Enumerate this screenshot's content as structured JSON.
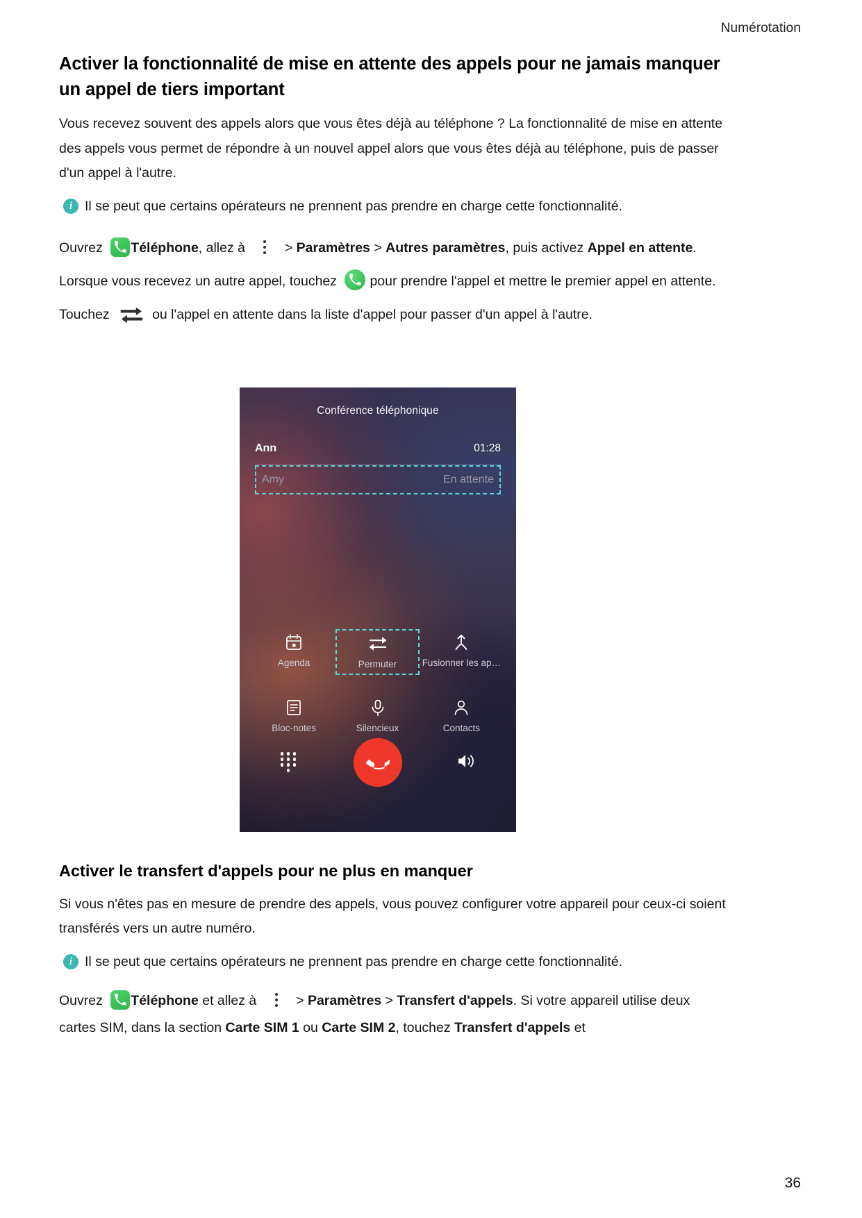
{
  "header": {
    "running_title": "Numérotation"
  },
  "page_number": "36",
  "section1": {
    "title": "Activer la fonctionnalité de mise en attente des appels pour ne jamais manquer un appel de tiers important",
    "paragraph": "Vous recevez souvent des appels alors que vous êtes déjà au téléphone ? La fonctionnalité de mise en attente des appels vous permet de répondre à un nouvel appel alors que vous êtes déjà au téléphone, puis de passer d'un appel à l'autre.",
    "note": "Il se peut que certains opérateurs ne prennent pas prendre en charge cette fonctionnalité.",
    "steps": {
      "t1": "Ouvrez",
      "app_label": "Téléphone",
      "t2": ", allez à",
      "sep1": ">",
      "settings": "Paramètres",
      "sep2": ">",
      "other_settings": "Autres paramètres",
      "t3": ", puis activez",
      "feature_a": "Appel en",
      "feature_b": "attente",
      "t4": ". Lorsque vous recevez un autre appel, touchez",
      "t5": "pour prendre l'appel et mettre le premier appel en attente. Touchez",
      "t6": "ou l'appel en attente dans la liste d'appel pour passer d'un appel à l'autre."
    }
  },
  "screenshot": {
    "title": "Conférence téléphonique",
    "calls": [
      {
        "name": "Ann",
        "status": "01:28",
        "held": false
      },
      {
        "name": "Amy",
        "status": "En attente",
        "held": true
      }
    ],
    "actions": [
      {
        "label": "Agenda",
        "icon": "calendar-icon",
        "selected": false
      },
      {
        "label": "Permuter",
        "icon": "swap-icon",
        "selected": true
      },
      {
        "label": "Fusionner les ap…",
        "icon": "merge-call-icon",
        "selected": false
      },
      {
        "label": "Bloc-notes",
        "icon": "notepad-icon",
        "selected": false
      },
      {
        "label": "Silencieux",
        "icon": "microphone-icon",
        "selected": false
      },
      {
        "label": "Contacts",
        "icon": "contacts-icon",
        "selected": false
      }
    ],
    "bottom": {
      "keypad": "keypad-icon",
      "hangup": "end-call-icon",
      "speaker": "speaker-icon",
      "hangup_color": "#f0372b"
    }
  },
  "section2": {
    "title": "Activer le transfert d'appels pour ne plus en manquer",
    "paragraph": "Si vous n'êtes pas en mesure de prendre des appels, vous pouvez configurer votre appareil pour ceux-ci soient transférés vers un autre numéro.",
    "note": "Il se peut que certains opérateurs ne prennent pas prendre en charge cette fonctionnalité.",
    "steps": {
      "t1": "Ouvrez",
      "app_label": "Téléphone",
      "t2": "et allez à",
      "sep1": ">",
      "settings": "Paramètres",
      "sep2": ">",
      "forwarding": "Transfert d'appels",
      "t3": ". Si votre appareil utilise deux cartes SIM, dans la section",
      "sim1": "Carte SIM 1",
      "t4": "ou",
      "sim2": "Carte SIM 2",
      "t5": ", touchez",
      "forwarding2": "Transfert d'appels",
      "t6": "et"
    }
  },
  "colors": {
    "info_icon": "#3db6b6",
    "dashed_highlight": "#5fd4d4",
    "phone_app_green": "#3fc45c",
    "hangup_red": "#f0372b"
  }
}
